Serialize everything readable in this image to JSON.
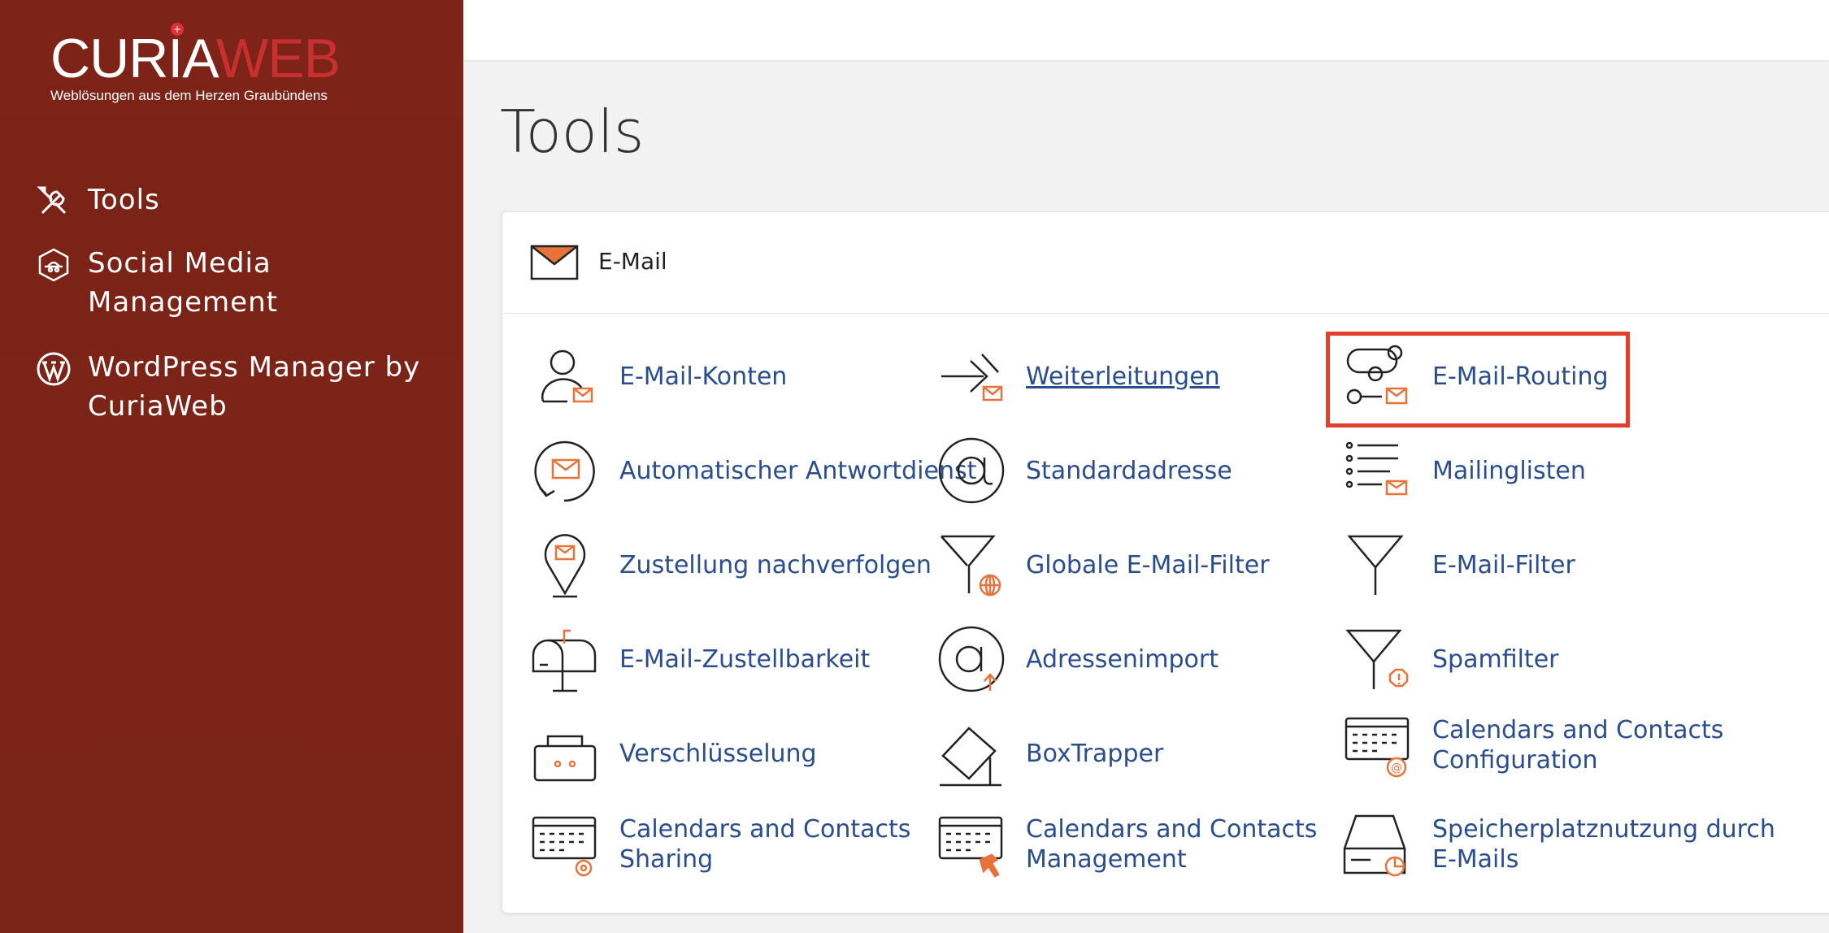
{
  "brand": {
    "name_part1": "CURIA",
    "name_part2": "WEB",
    "tagline": "Weblösungen aus dem Herzen Graubündens",
    "accent": "#c8302f"
  },
  "sidebar": {
    "background": "#7a2417",
    "items": [
      {
        "label": "Tools",
        "icon": "tools-icon"
      },
      {
        "label": "Social Media Management",
        "icon": "social-media-icon"
      },
      {
        "label": "WordPress Manager by CuriaWeb",
        "icon": "wordpress-icon"
      }
    ]
  },
  "page": {
    "title": "Tools"
  },
  "email_panel": {
    "title": "E-Mail",
    "tools": [
      {
        "label": "E-Mail-Konten",
        "icon": "email-accounts-icon"
      },
      {
        "label": "Weiterleitungen",
        "icon": "forwarders-icon"
      },
      {
        "label": "E-Mail-Routing",
        "icon": "email-routing-icon",
        "highlighted": true
      },
      {
        "label": "Automatischer Antwortdienst",
        "icon": "autoresponder-icon"
      },
      {
        "label": "Standardadresse",
        "icon": "default-address-icon"
      },
      {
        "label": "Mailinglisten",
        "icon": "mailing-lists-icon"
      },
      {
        "label": "Zustellung nachverfolgen",
        "icon": "track-delivery-icon"
      },
      {
        "label": "Globale E-Mail-Filter",
        "icon": "global-filter-icon"
      },
      {
        "label": "E-Mail-Filter",
        "icon": "email-filter-icon"
      },
      {
        "label": "E-Mail-Zustellbarkeit",
        "icon": "deliverability-icon"
      },
      {
        "label": "Adressenimport",
        "icon": "address-import-icon"
      },
      {
        "label": "Spamfilter",
        "icon": "spam-filter-icon"
      },
      {
        "label": "Verschlüsselung",
        "icon": "encryption-icon"
      },
      {
        "label": "BoxTrapper",
        "icon": "boxtrapper-icon"
      },
      {
        "label1": "Calendars and Contacts",
        "label2": "Configuration",
        "icon": "calendar-config-icon"
      },
      {
        "label1": "Calendars and Contacts",
        "label2": "Sharing",
        "icon": "calendar-sharing-icon"
      },
      {
        "label1": "Calendars and Contacts",
        "label2": "Management",
        "icon": "calendar-management-icon"
      },
      {
        "label1": "Speicherplatznutzung durch",
        "label2": "E-Mails",
        "icon": "disk-usage-icon"
      }
    ]
  },
  "colors": {
    "link": "#2a4d8f",
    "icon_accent": "#e8733a",
    "highlight": "#e0402c"
  }
}
